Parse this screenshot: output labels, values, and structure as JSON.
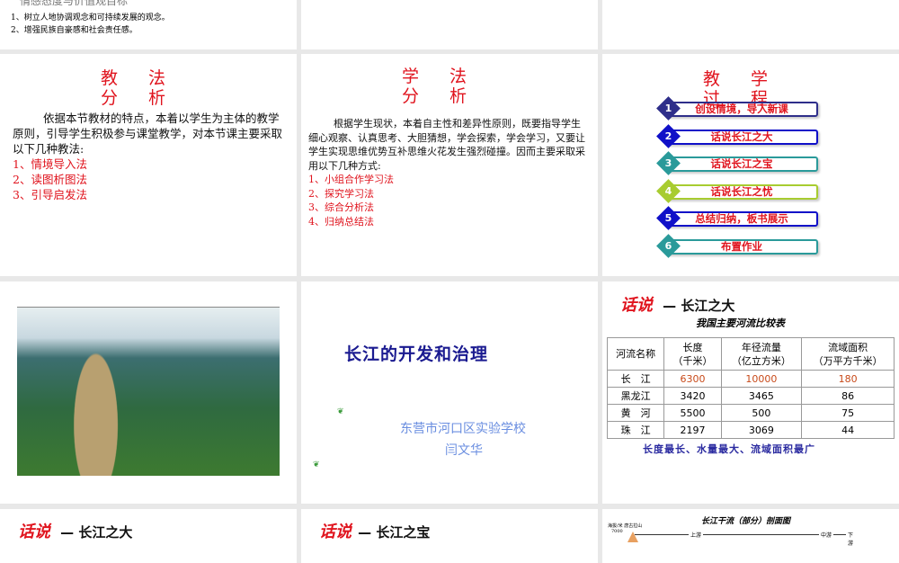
{
  "slide1": {
    "heading": "情感态度与价值观目标",
    "items": [
      "1、树立人地协调观念和可持续发展的观念。",
      "2、增强民族自豪感和社会责任感。"
    ]
  },
  "slide3": {
    "title": "教 法 分 析",
    "intro": "依据本节教材的特点，本着以学生为主体的教学原则，引导学生积极参与课堂教学，对本节课主要采取以下几种教法:",
    "items": [
      "1、情境导入法",
      "2、读图析图法",
      "3、引导启发法"
    ]
  },
  "slide4": {
    "title": "学 法 分 析",
    "intro": "根据学生现状，本着自主性和差异性原则，既要指导学生细心观察、认真思考、大胆猜想，学会探索，学会学习，又要让学生实现思维优势互补思维火花发生强烈碰撞。因而主要采取采用以下几种方式:",
    "items": [
      "1、小组合作学习法",
      "2、探究学习法",
      "3、综合分析法",
      "4、归纳总结法"
    ]
  },
  "slide5": {
    "title": "教 学 过 程",
    "steps": [
      {
        "num": "1",
        "label": "创设情境，导入新课",
        "color": "#2e2e8a"
      },
      {
        "num": "2",
        "label": "话说长江之大",
        "color": "#1010c8"
      },
      {
        "num": "3",
        "label": "话说长江之宝",
        "color": "#2a9a9a"
      },
      {
        "num": "4",
        "label": "话说长江之忧",
        "color": "#a8cc30"
      },
      {
        "num": "5",
        "label": "总结归纳，板书展示",
        "color": "#1010c8"
      },
      {
        "num": "6",
        "label": "布置作业",
        "color": "#2a9a9a"
      }
    ]
  },
  "slide7": {
    "title": "长江的开发和治理",
    "school": "东营市河口区实验学校",
    "author": "闫文华"
  },
  "slide8": {
    "badge": "话说",
    "heading": "— 长江之大",
    "table_title": "我国主要河流比较表",
    "headers": [
      [
        "河流名称",
        ""
      ],
      [
        "长度",
        "（千米）"
      ],
      [
        "年径流量",
        "（亿立方米）"
      ],
      [
        "流域面积",
        "（万平方千米）"
      ]
    ],
    "rows": [
      [
        "长　江",
        "6300",
        "10000",
        "180"
      ],
      [
        "黑龙江",
        "3420",
        "3465",
        "86"
      ],
      [
        "黄　河",
        "5500",
        "500",
        "75"
      ],
      [
        "珠　江",
        "2197",
        "3069",
        "44"
      ]
    ],
    "summary": "长度最长、水量最大、流域面积最广"
  },
  "slide9": {
    "badge": "话说",
    "heading": "— 长江之大"
  },
  "slide10": {
    "badge": "话说",
    "heading": "— 长江之宝"
  },
  "slide11": {
    "title": "长江干流（部分）剖面图",
    "axis_label": "海拔/米 唐古拉山",
    "tick": "7000",
    "segments": [
      "上游",
      "中游",
      "下游"
    ]
  }
}
